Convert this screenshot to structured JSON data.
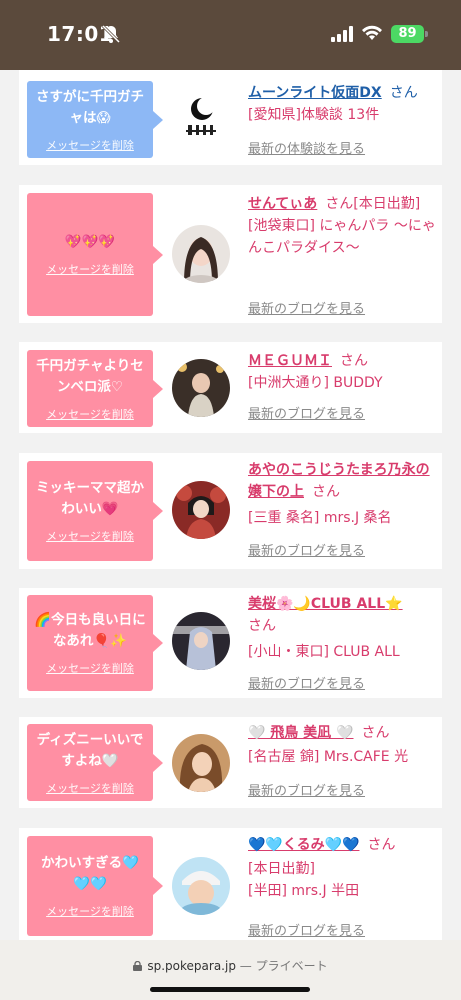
{
  "status": {
    "time": "17:01",
    "battery": "89"
  },
  "browser": {
    "domain": "sp.pokepara.jp",
    "mode": "— プライベート"
  },
  "cards": [
    {
      "message": "さすがに千円ガチャは😱",
      "delete": "メッセージを削除",
      "name": "ムーンライト仮面DX",
      "suffix": "さん",
      "lines": [
        "[愛知県]体験談 13件"
      ],
      "link": "最新の体験談を見る"
    },
    {
      "message": "💖💖💖",
      "delete": "メッセージを削除",
      "name": "せんてぃあ",
      "suffix": "さん[本日出勤]",
      "lines": [
        "[池袋東口] にゃんパラ 〜にゃんこパラダイス〜"
      ],
      "link": "最新のブログを見る"
    },
    {
      "message": "千円ガチャよりセンベロ派♡",
      "delete": "メッセージを削除",
      "name": "ＭＥＧＵＭＩ",
      "suffix": "さん",
      "lines": [
        "[中洲大通り] BUDDY"
      ],
      "link": "最新のブログを見る"
    },
    {
      "message": "ミッキーママ超かわいい💗",
      "delete": "メッセージを削除",
      "name": "あやのこうじうたまろ乃永の嬢下の上",
      "suffix": "さん",
      "lines": [
        "[三重 桑名] mrs.J 桑名"
      ],
      "link": "最新のブログを見る"
    },
    {
      "message": "🌈今日も良い日になあれ🎈✨",
      "delete": "メッセージを削除",
      "name": "美桜🌸🌙CLUB ALL⭐",
      "suffix": "さん",
      "lines": [
        "[小山・東口] CLUB ALL"
      ],
      "link": "最新のブログを見る"
    },
    {
      "message": "ディズニーいいですよね🤍",
      "delete": "メッセージを削除",
      "name": "🤍 飛鳥 美凪 🤍",
      "suffix": "さん",
      "lines": [
        "[名古屋 錦] Mrs.CAFE 光"
      ],
      "link": "最新のブログを見る"
    },
    {
      "message": "かわいすぎる🩵🩵🩵",
      "delete": "メッセージを削除",
      "name": "💙🩵くるみ🩵💙",
      "suffix": "さん",
      "lines": [
        "[本日出勤]",
        "[半田] mrs.J 半田"
      ],
      "link": "最新のブログを見る"
    }
  ],
  "colors": {
    "pink": "#ff8fa3",
    "blue": "#8db8f5",
    "accent": "#d83c6c",
    "statusbar": "#5b4a3c"
  }
}
